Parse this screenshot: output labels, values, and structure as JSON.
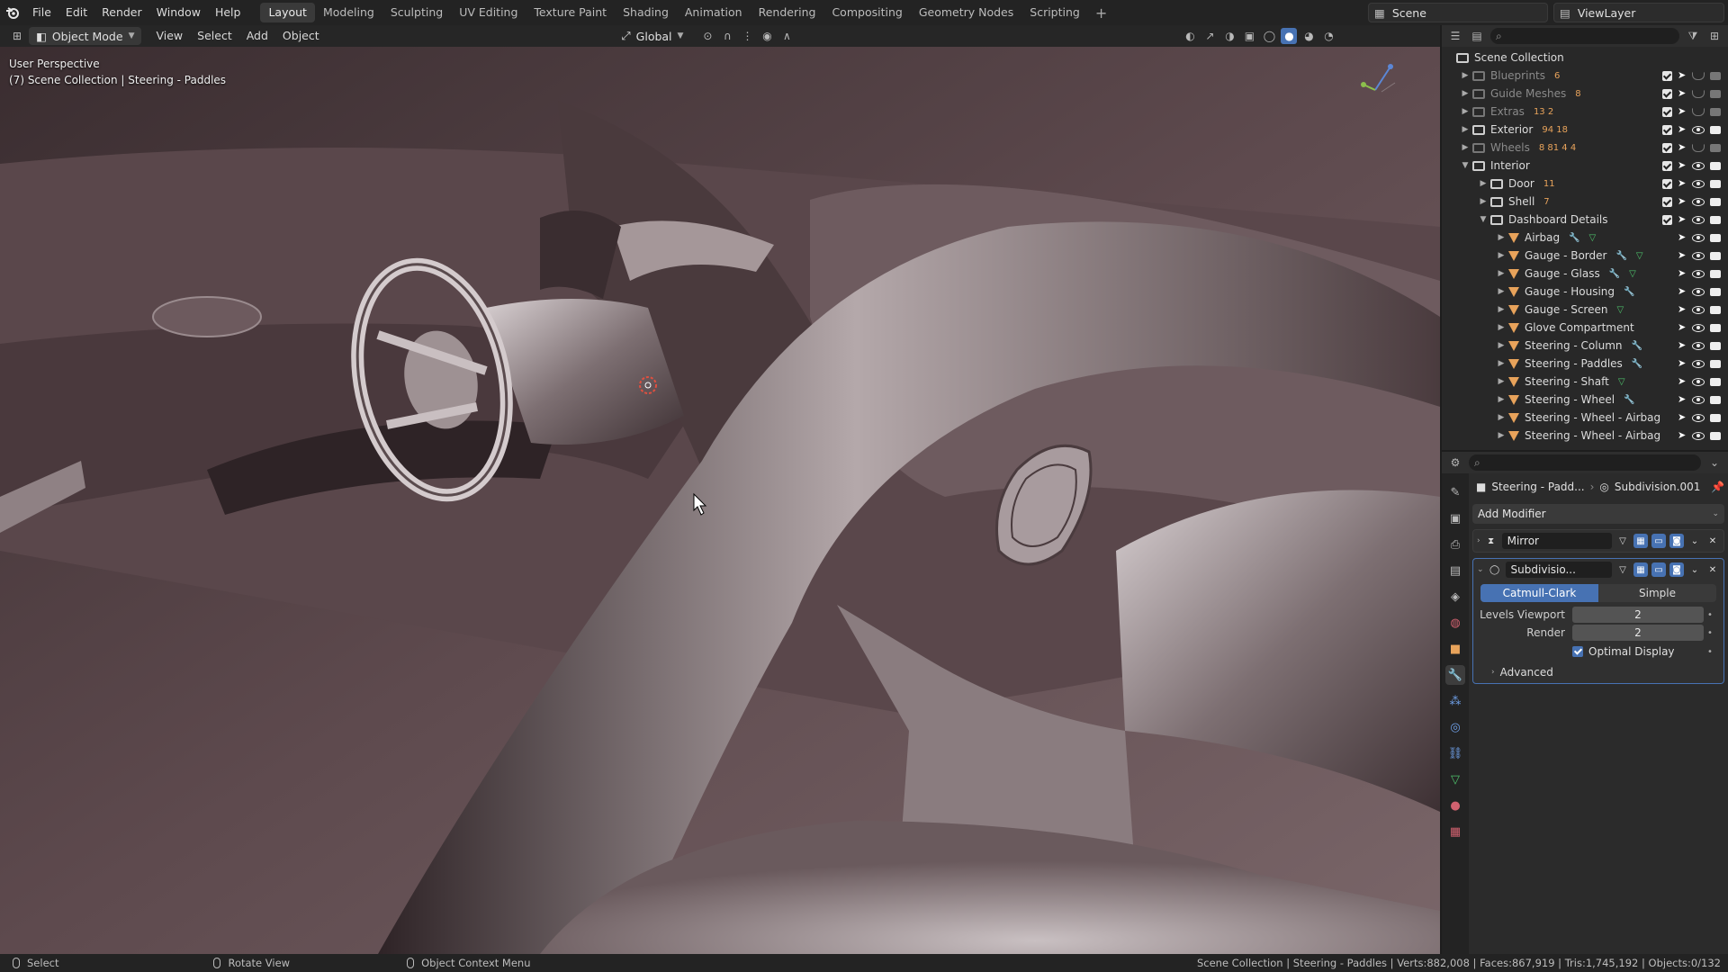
{
  "topbar": {
    "menus": [
      "File",
      "Edit",
      "Render",
      "Window",
      "Help"
    ],
    "workspaces": [
      "Layout",
      "Modeling",
      "Sculpting",
      "UV Editing",
      "Texture Paint",
      "Shading",
      "Animation",
      "Rendering",
      "Compositing",
      "Geometry Nodes",
      "Scripting"
    ],
    "active_workspace": "Layout",
    "add_label": "+",
    "scene": "Scene",
    "view_layer": "ViewLayer"
  },
  "viewport_header": {
    "mode": "Object Mode",
    "menus": [
      "View",
      "Select",
      "Add",
      "Object"
    ],
    "orientation": "Global"
  },
  "viewport": {
    "perspective": "User Perspective",
    "context": "(7) Scene Collection | Steering - Paddles"
  },
  "outliner": {
    "root": "Scene Collection",
    "rows": [
      {
        "label": "Blueprints",
        "extra": "6",
        "dim": true
      },
      {
        "label": "Guide Meshes",
        "extra": "8",
        "dim": true
      },
      {
        "label": "Extras",
        "extra": "13 2",
        "dim": true
      },
      {
        "label": "Exterior",
        "extra": "94 18",
        "dim": false
      },
      {
        "label": "Wheels",
        "extra": "8 81 4 4",
        "dim": true
      },
      {
        "label": "Interior",
        "extra": "",
        "dim": false
      },
      {
        "label": "Door",
        "extra": "11",
        "dim": false
      },
      {
        "label": "Shell",
        "extra": "7",
        "dim": false
      },
      {
        "label": "Dashboard Details",
        "extra": "",
        "dim": false
      },
      {
        "label": "Airbag",
        "extra": "",
        "dim": false
      },
      {
        "label": "Gauge - Border",
        "extra": "",
        "dim": false
      },
      {
        "label": "Gauge - Glass",
        "extra": "",
        "dim": false
      },
      {
        "label": "Gauge - Housing",
        "extra": "",
        "dim": false
      },
      {
        "label": "Gauge - Screen",
        "extra": "",
        "dim": false
      },
      {
        "label": "Glove Compartment",
        "extra": "",
        "dim": false
      },
      {
        "label": "Steering - Column",
        "extra": "",
        "dim": false
      },
      {
        "label": "Steering - Paddles",
        "extra": "",
        "dim": false
      },
      {
        "label": "Steering - Shaft",
        "extra": "",
        "dim": false
      },
      {
        "label": "Steering - Wheel",
        "extra": "",
        "dim": false
      },
      {
        "label": "Steering - Wheel - Airbag",
        "extra": "",
        "dim": false
      },
      {
        "label": "Steering - Wheel - Airbag",
        "extra": "",
        "dim": false
      }
    ]
  },
  "properties": {
    "object_name": "Steering - Padd...",
    "modifier_name": "Subdivision.001",
    "add_modifier": "Add Modifier",
    "mirror": "Mirror",
    "subdiv": "Subdivisio...",
    "catmull": "Catmull-Clark",
    "simple": "Simple",
    "levels_viewport_label": "Levels Viewport",
    "levels_viewport_value": "2",
    "render_label": "Render",
    "render_value": "2",
    "optimal_display": "Optimal Display",
    "advanced": "Advanced"
  },
  "statusbar": {
    "select": "Select",
    "rotate": "Rotate View",
    "context_menu": "Object Context Menu",
    "stats": "Scene Collection | Steering - Paddles | Verts:882,008 | Faces:867,919 | Tris:1,745,192 | Objects:0/132"
  },
  "colors": {
    "accent": "#4772b3",
    "mesh_icon": "#e8a35b",
    "viewport_base": "#4a3a3c"
  }
}
